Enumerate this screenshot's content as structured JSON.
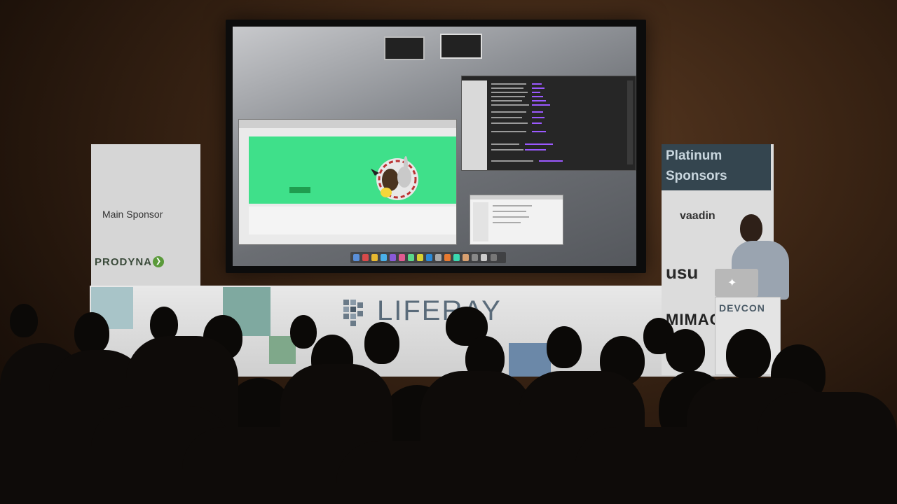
{
  "sponsors": {
    "main_label": "Main Sponsor",
    "main_name": "PRODYNA",
    "platinum_label_line1": "Platinum",
    "platinum_label_line2": "Sponsors",
    "platinum_1": "vaadin",
    "platinum_2": "usu",
    "platinum_3": "MIMACO"
  },
  "stage": {
    "backdrop_logo": "LIFERAY",
    "podium_label": "DEVCON"
  },
  "colors": {
    "hero_green": "#3fe08a",
    "platinum_panel": "#34454f",
    "prodyna_green": "#5a9a3a"
  },
  "icons": {
    "laptop_logo": "apple-logo-icon",
    "prodyna_mark": "arrow-circle-icon"
  }
}
